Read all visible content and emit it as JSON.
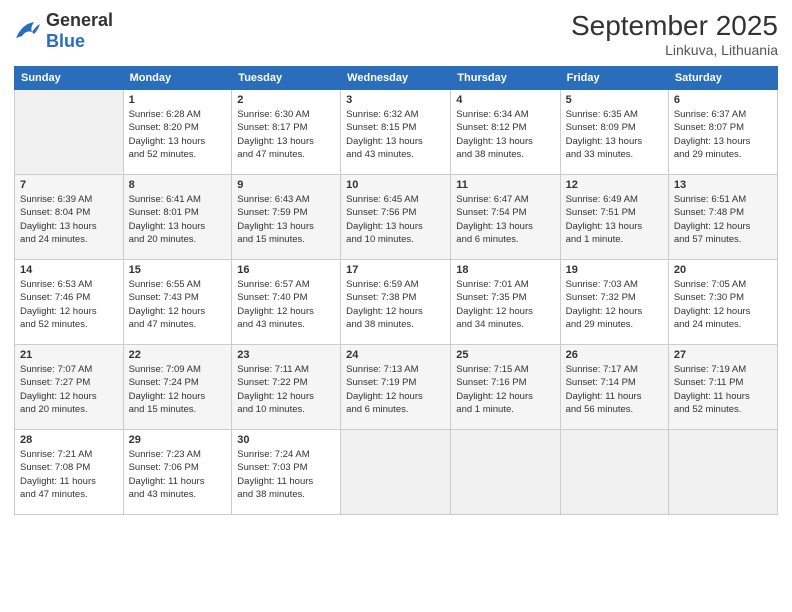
{
  "header": {
    "logo": {
      "text_general": "General",
      "text_blue": "Blue"
    },
    "title": "September 2025",
    "location": "Linkuva, Lithuania"
  },
  "days_of_week": [
    "Sunday",
    "Monday",
    "Tuesday",
    "Wednesday",
    "Thursday",
    "Friday",
    "Saturday"
  ],
  "weeks": [
    [
      {
        "day": "",
        "info": ""
      },
      {
        "day": "1",
        "info": "Sunrise: 6:28 AM\nSunset: 8:20 PM\nDaylight: 13 hours\nand 52 minutes."
      },
      {
        "day": "2",
        "info": "Sunrise: 6:30 AM\nSunset: 8:17 PM\nDaylight: 13 hours\nand 47 minutes."
      },
      {
        "day": "3",
        "info": "Sunrise: 6:32 AM\nSunset: 8:15 PM\nDaylight: 13 hours\nand 43 minutes."
      },
      {
        "day": "4",
        "info": "Sunrise: 6:34 AM\nSunset: 8:12 PM\nDaylight: 13 hours\nand 38 minutes."
      },
      {
        "day": "5",
        "info": "Sunrise: 6:35 AM\nSunset: 8:09 PM\nDaylight: 13 hours\nand 33 minutes."
      },
      {
        "day": "6",
        "info": "Sunrise: 6:37 AM\nSunset: 8:07 PM\nDaylight: 13 hours\nand 29 minutes."
      }
    ],
    [
      {
        "day": "7",
        "info": "Sunrise: 6:39 AM\nSunset: 8:04 PM\nDaylight: 13 hours\nand 24 minutes."
      },
      {
        "day": "8",
        "info": "Sunrise: 6:41 AM\nSunset: 8:01 PM\nDaylight: 13 hours\nand 20 minutes."
      },
      {
        "day": "9",
        "info": "Sunrise: 6:43 AM\nSunset: 7:59 PM\nDaylight: 13 hours\nand 15 minutes."
      },
      {
        "day": "10",
        "info": "Sunrise: 6:45 AM\nSunset: 7:56 PM\nDaylight: 13 hours\nand 10 minutes."
      },
      {
        "day": "11",
        "info": "Sunrise: 6:47 AM\nSunset: 7:54 PM\nDaylight: 13 hours\nand 6 minutes."
      },
      {
        "day": "12",
        "info": "Sunrise: 6:49 AM\nSunset: 7:51 PM\nDaylight: 13 hours\nand 1 minute."
      },
      {
        "day": "13",
        "info": "Sunrise: 6:51 AM\nSunset: 7:48 PM\nDaylight: 12 hours\nand 57 minutes."
      }
    ],
    [
      {
        "day": "14",
        "info": "Sunrise: 6:53 AM\nSunset: 7:46 PM\nDaylight: 12 hours\nand 52 minutes."
      },
      {
        "day": "15",
        "info": "Sunrise: 6:55 AM\nSunset: 7:43 PM\nDaylight: 12 hours\nand 47 minutes."
      },
      {
        "day": "16",
        "info": "Sunrise: 6:57 AM\nSunset: 7:40 PM\nDaylight: 12 hours\nand 43 minutes."
      },
      {
        "day": "17",
        "info": "Sunrise: 6:59 AM\nSunset: 7:38 PM\nDaylight: 12 hours\nand 38 minutes."
      },
      {
        "day": "18",
        "info": "Sunrise: 7:01 AM\nSunset: 7:35 PM\nDaylight: 12 hours\nand 34 minutes."
      },
      {
        "day": "19",
        "info": "Sunrise: 7:03 AM\nSunset: 7:32 PM\nDaylight: 12 hours\nand 29 minutes."
      },
      {
        "day": "20",
        "info": "Sunrise: 7:05 AM\nSunset: 7:30 PM\nDaylight: 12 hours\nand 24 minutes."
      }
    ],
    [
      {
        "day": "21",
        "info": "Sunrise: 7:07 AM\nSunset: 7:27 PM\nDaylight: 12 hours\nand 20 minutes."
      },
      {
        "day": "22",
        "info": "Sunrise: 7:09 AM\nSunset: 7:24 PM\nDaylight: 12 hours\nand 15 minutes."
      },
      {
        "day": "23",
        "info": "Sunrise: 7:11 AM\nSunset: 7:22 PM\nDaylight: 12 hours\nand 10 minutes."
      },
      {
        "day": "24",
        "info": "Sunrise: 7:13 AM\nSunset: 7:19 PM\nDaylight: 12 hours\nand 6 minutes."
      },
      {
        "day": "25",
        "info": "Sunrise: 7:15 AM\nSunset: 7:16 PM\nDaylight: 12 hours\nand 1 minute."
      },
      {
        "day": "26",
        "info": "Sunrise: 7:17 AM\nSunset: 7:14 PM\nDaylight: 11 hours\nand 56 minutes."
      },
      {
        "day": "27",
        "info": "Sunrise: 7:19 AM\nSunset: 7:11 PM\nDaylight: 11 hours\nand 52 minutes."
      }
    ],
    [
      {
        "day": "28",
        "info": "Sunrise: 7:21 AM\nSunset: 7:08 PM\nDaylight: 11 hours\nand 47 minutes."
      },
      {
        "day": "29",
        "info": "Sunrise: 7:23 AM\nSunset: 7:06 PM\nDaylight: 11 hours\nand 43 minutes."
      },
      {
        "day": "30",
        "info": "Sunrise: 7:24 AM\nSunset: 7:03 PM\nDaylight: 11 hours\nand 38 minutes."
      },
      {
        "day": "",
        "info": ""
      },
      {
        "day": "",
        "info": ""
      },
      {
        "day": "",
        "info": ""
      },
      {
        "day": "",
        "info": ""
      }
    ]
  ]
}
